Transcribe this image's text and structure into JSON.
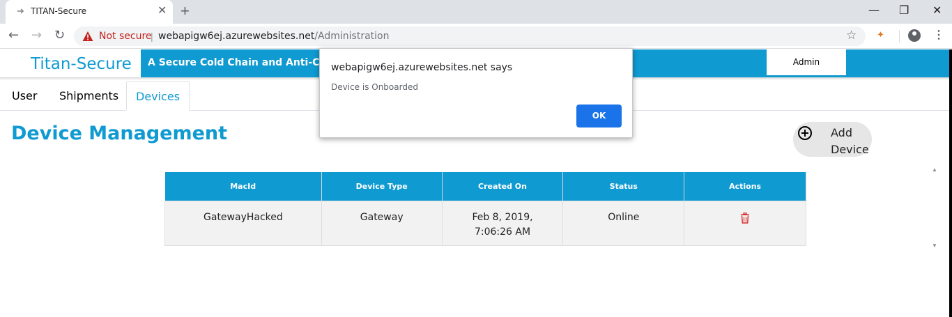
{
  "browser": {
    "tab_title": "TITAN-Secure",
    "tab_close": "✕",
    "new_tab": "+",
    "security_label": "Not secure",
    "separator": "|",
    "url_host": "webapigw6ej.azurewebsites.net",
    "url_path": "/Administration",
    "window_minimize": "—",
    "window_restore": "❐",
    "window_close": "✕",
    "back": "←",
    "forward": "→",
    "reload": "↻",
    "star": "☆",
    "menu": "⋮",
    "icons": [
      "arrow-favicon-icon",
      "warning-icon",
      "star-icon",
      "fox-extension-icon",
      "profile-icon",
      "menu-icon"
    ]
  },
  "app": {
    "brand": "Titan-Secure",
    "banner_text": "A Secure Cold Chain and Anti-Counter",
    "admin_label": "Admin",
    "accent_color": "#0f9ad1"
  },
  "nav_tabs": [
    {
      "label": "User"
    },
    {
      "label": "Shipments"
    },
    {
      "label": "Devices",
      "active": true
    }
  ],
  "page_title": "Device Management",
  "add_device_label": "Add Device",
  "table": {
    "headers": [
      "MacId",
      "Device Type",
      "Created On",
      "Status",
      "Actions"
    ],
    "rows": [
      {
        "macid": "GatewayHacked",
        "device_type": "Gateway",
        "created_on": "Feb 8, 2019, 7:06:26 AM",
        "status": "Online",
        "status_color": "#1e7e34"
      }
    ]
  },
  "dialog": {
    "title": "webapigw6ej.azurewebsites.net says",
    "message": "Device is Onboarded",
    "ok_label": "OK"
  }
}
